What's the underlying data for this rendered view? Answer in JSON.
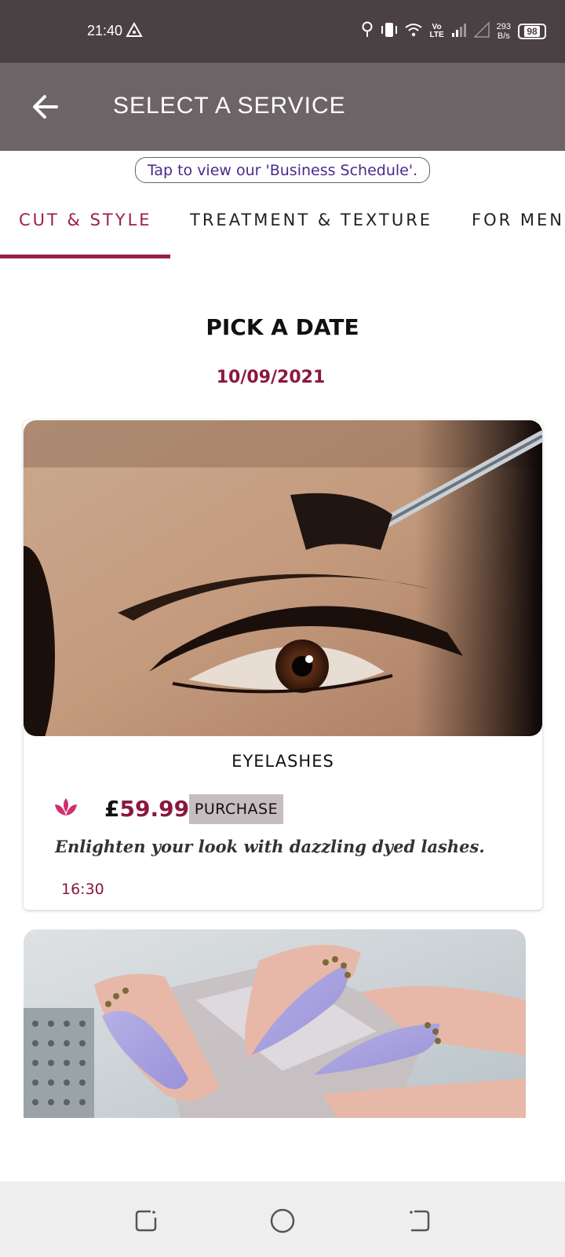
{
  "status_bar": {
    "time": "21:40",
    "vo": "Vo",
    "lte": "LTE",
    "speed_value": "293",
    "speed_unit": "B/s",
    "battery": "98"
  },
  "header": {
    "title": "SELECT A SERVICE",
    "back_icon": "arrow-left-icon"
  },
  "schedule_link": "Tap to view our 'Business Schedule'.",
  "tabs": [
    {
      "label": "CUT & STYLE",
      "active": true
    },
    {
      "label": "TREATMENT & TEXTURE",
      "active": false
    },
    {
      "label": "FOR MEN",
      "active": false
    }
  ],
  "date_picker": {
    "title": "PICK A DATE",
    "date": "10/09/2021"
  },
  "services": [
    {
      "name": "EYELASHES",
      "currency": "£",
      "price": "59.99",
      "purchase_label": "PURCHASE",
      "description": "Enlighten your look with dazzling dyed lashes.",
      "time": "16:30",
      "image": "eyelash-application-photo"
    },
    {
      "image": "lilac-stiletto-nails-photo"
    }
  ],
  "colors": {
    "accent": "#9c1e4a",
    "status_bar": "#4a4144",
    "app_bar": "#6c6466",
    "purchase_bg": "#c6bdc1",
    "lotus": "#d12f6e"
  },
  "nav_bar": {
    "icons": [
      "recents-icon",
      "home-icon",
      "back-gesture-icon"
    ]
  }
}
